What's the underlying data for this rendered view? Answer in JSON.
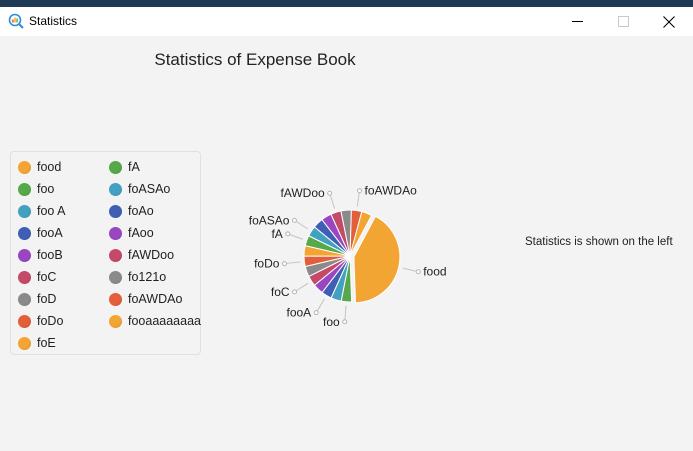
{
  "window": {
    "title": "Statistics"
  },
  "chart_data": {
    "type": "pie",
    "title": "Statistics of Expense Book",
    "legend_position": "left",
    "categories": [
      "food",
      "foo",
      "foo A",
      "fooA",
      "fooB",
      "foC",
      "foD",
      "foDo",
      "foE",
      "fA",
      "foASAo",
      "foAo",
      "fAoo",
      "fAWDoo",
      "fo121o",
      "foAWDAo",
      "fooaaaaaaaa"
    ],
    "values": [
      40,
      3.5,
      3.5,
      3.5,
      3.5,
      3.5,
      3.5,
      3.5,
      3.5,
      3.5,
      3.5,
      3.5,
      3.5,
      3.5,
      3.5,
      3.5,
      3.5
    ],
    "colors": [
      "#f3a533",
      "#56a84a",
      "#42a1c0",
      "#3f5fb5",
      "#9a46c2",
      "#c44a68",
      "#8a8a8a",
      "#e35f3a",
      "#f3a533",
      "#56a84a",
      "#42a1c0",
      "#3f5fb5",
      "#9a46c2",
      "#c44a68",
      "#8a8a8a",
      "#e35f3a",
      "#f3a533"
    ],
    "slice_labels_visible": [
      "food",
      "foo",
      "fooA",
      "foC",
      "foDo",
      "fA",
      "foASAo",
      "fAWDoo",
      "foAWDAo"
    ]
  },
  "note": "Statistics is shown on the left"
}
